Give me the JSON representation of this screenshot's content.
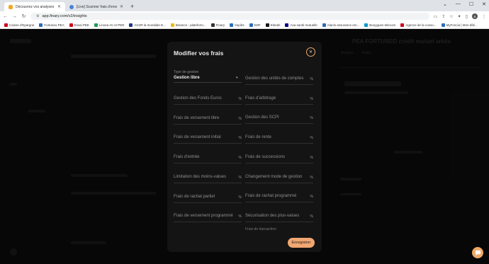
{
  "browser": {
    "tabs": [
      {
        "title": "Découvrez vos analyses | Finary",
        "active": true
      },
      {
        "title": "[Live] Scanner frais d'envelopp...",
        "active": false
      }
    ],
    "url": "app.finary.com/v2/insights",
    "profile_initial": "B",
    "bookmarks": [
      {
        "label": "Caisse d'Epargne",
        "color": "#d0021b"
      },
      {
        "label": "Fortuneo PEA",
        "color": "#2c6db8"
      },
      {
        "label": "Essai PEE",
        "color": "#d0021b"
      },
      {
        "label": "Linxea AV et PER",
        "color": "#1f9d55"
      },
      {
        "label": "AG2R la mondiale E...",
        "color": "#1a3a8a"
      },
      {
        "label": "Binance - plateform...",
        "color": "#f0b90b"
      },
      {
        "label": "Finary",
        "color": "#333333"
      },
      {
        "label": "Impôts",
        "color": "#2c6db8"
      },
      {
        "label": "EDF",
        "color": "#2c6db8"
      },
      {
        "label": "Eleeds",
        "color": "#1a1a1a"
      },
      {
        "label": "Axa santé mutuelle",
        "color": "#00008f"
      },
      {
        "label": "Alanis assurance em...",
        "color": "#2c6db8"
      },
      {
        "label": "Bouygues telecom",
        "color": "#009dcc"
      },
      {
        "label": "Agence de la conso...",
        "color": "#d0021b"
      },
      {
        "label": "MyFoncia | Mon télé...",
        "color": "#2c6db8"
      }
    ]
  },
  "background": {
    "right_title": "PEA FORTUNEO crédit mutuel arkéa",
    "right_tabs": [
      "Analyse",
      "Actifs"
    ]
  },
  "modal": {
    "title": "Modifier vos frais",
    "type_label": "Type de gestion",
    "type_value": "Gestion libre",
    "fields_left": [
      "Gestion des Fonds Euros",
      "Frais de versement libre",
      "Frais de versement initial",
      "Frais d'entrée",
      "Limitation des moins-values",
      "Frais de rachat partiel",
      "Frais de versement programmé"
    ],
    "fields_right": [
      "Gestion des unités de comptes",
      "Frais d'arbitrage",
      "Gestion des SCPI",
      "Frais de rente",
      "Frais de successions",
      "Changement mode de gestion",
      "Frais de rachat programmé",
      "Sécurisation des plus-values"
    ],
    "last_partial_label": "Frais de transaction",
    "percent_symbol": "%",
    "save_label": "Enregistrer"
  }
}
